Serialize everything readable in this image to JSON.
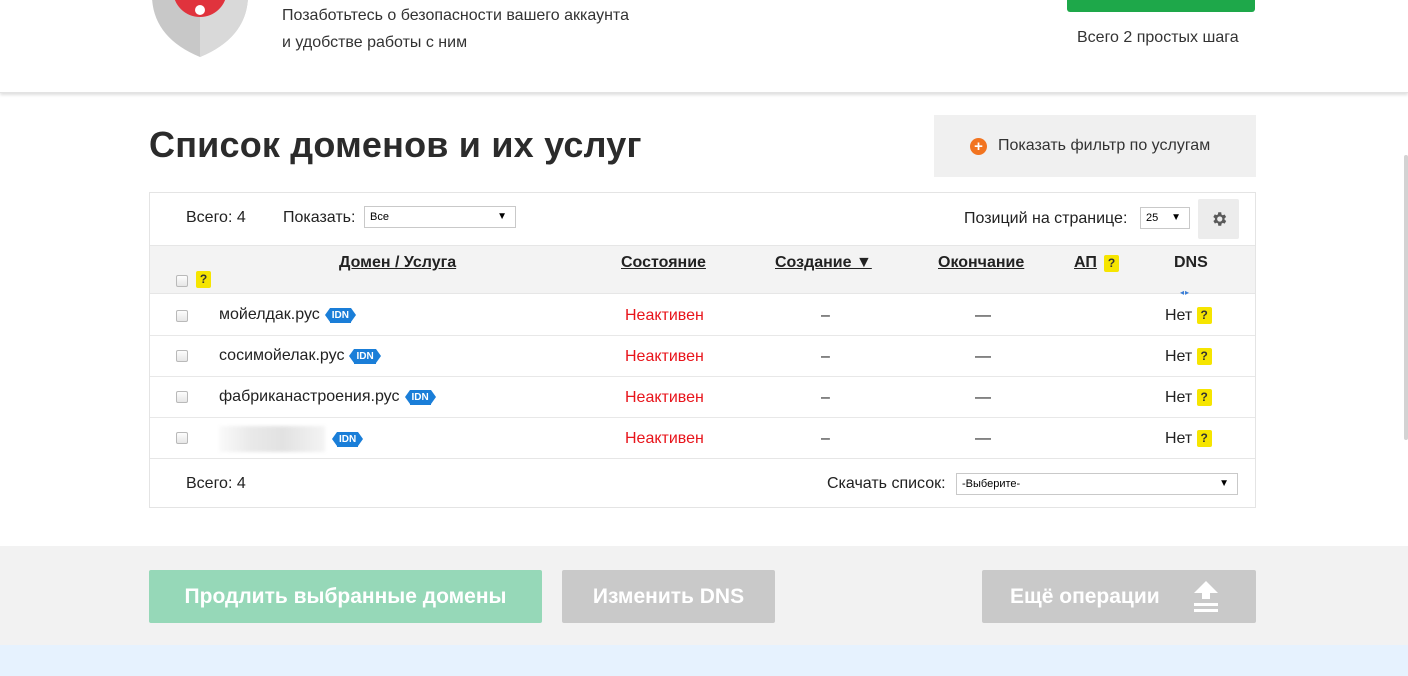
{
  "banner": {
    "line1": "Позаботьтесь о безопасности вашего аккаунта",
    "line2": "и удобстве работы с ним",
    "steps": "Всего 2 простых шага"
  },
  "page": {
    "title": "Список доменов и их услуг",
    "filter_button": "Показать фильтр по услугам"
  },
  "toolbar": {
    "total_label": "Всего: 4",
    "show_label": "Показать:",
    "show_value": "Все",
    "per_page_label": "Позиций на странице:",
    "per_page_value": "25"
  },
  "table": {
    "columns": {
      "domain": "Домен / Услуга",
      "status": "Состояние",
      "created": "Создание ▼",
      "expires": "Окончание",
      "ap": "АП",
      "dns": "DNS"
    },
    "help_mark": "?",
    "idn_badge": "IDN",
    "rows": [
      {
        "domain": "мойелдак.рус",
        "status": "Неактивен",
        "created": "–",
        "expires": "—",
        "dns": "Нет"
      },
      {
        "domain": "сосимойелак.рус",
        "status": "Неактивен",
        "created": "–",
        "expires": "—",
        "dns": "Нет"
      },
      {
        "domain": "фабриканастроения.рус",
        "status": "Неактивен",
        "created": "–",
        "expires": "—",
        "dns": "Нет"
      },
      {
        "domain": "",
        "status": "Неактивен",
        "created": "–",
        "expires": "—",
        "dns": "Нет"
      }
    ]
  },
  "footer": {
    "total_label": "Всего: 4",
    "download_label": "Скачать список:",
    "download_value": "-Выберите-"
  },
  "actions": {
    "renew": "Продлить выбранные домены",
    "change_dns": "Изменить DNS",
    "more": "Ещё операции"
  },
  "colors": {
    "status_inactive": "#e8141b",
    "idn_badge": "#1a7ed8",
    "help_mark": "#f6e500",
    "filter_plus": "#f27420",
    "renew_button": "#96d8b8",
    "banner_button": "#1ea84a"
  },
  "icons": {
    "shield": "shield-alert-icon",
    "filter": "plus-circle-icon",
    "settings": "gear-icon",
    "more": "upload-icon"
  }
}
